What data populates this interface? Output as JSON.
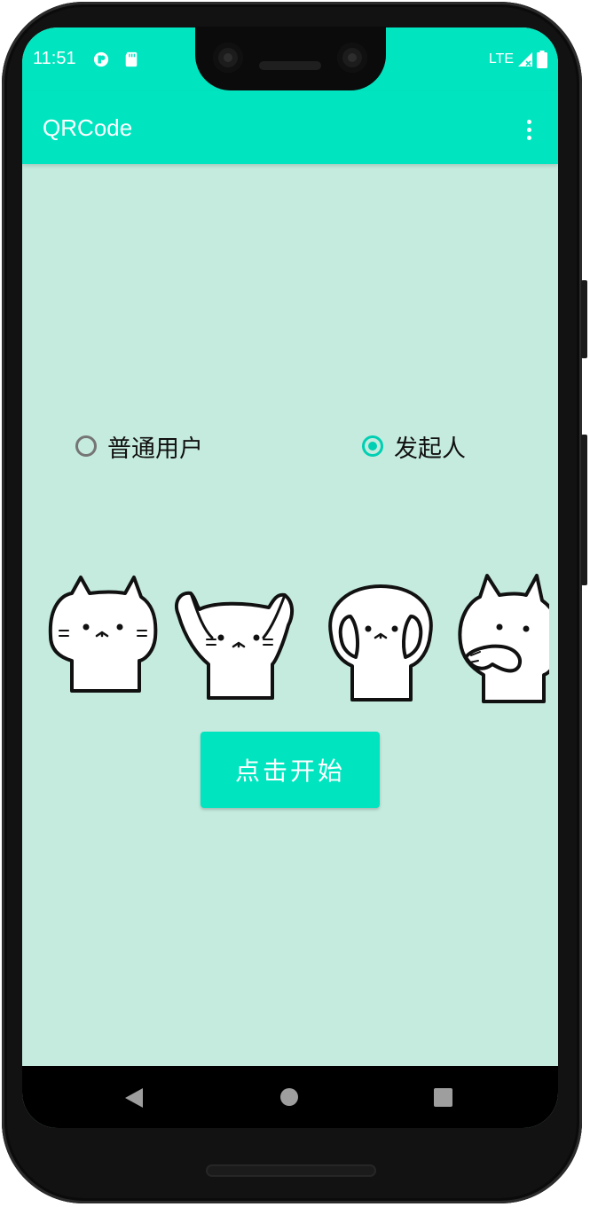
{
  "status_bar": {
    "time": "11:51",
    "network": "LTE",
    "icons": [
      "app-notification-icon",
      "sd-card-icon",
      "signal-icon",
      "battery-icon"
    ]
  },
  "app_bar": {
    "title": "QRCode",
    "menu_icon": "overflow-menu-icon"
  },
  "role_options": [
    {
      "label": "普通用户",
      "selected": false
    },
    {
      "label": "发起人",
      "selected": true
    }
  ],
  "illustration": {
    "icons": [
      "cat-sticker-icon",
      "cat-sticker-icon",
      "cat-sticker-icon",
      "cat-sticker-icon"
    ]
  },
  "start_button": {
    "label": "点击开始"
  },
  "nav_bar": {
    "icons": [
      "back-icon",
      "home-icon",
      "recents-icon"
    ]
  },
  "colors": {
    "primary": "#00E5C0",
    "background": "#C5EBDE",
    "radio_checked": "#00CFB3",
    "radio_unchecked": "#757575"
  }
}
